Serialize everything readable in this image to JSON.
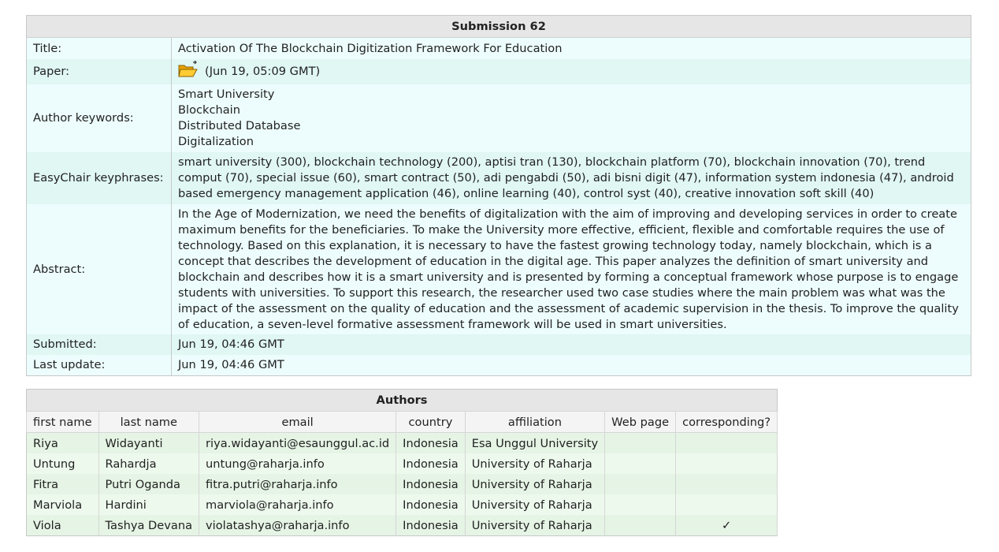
{
  "submission": {
    "caption": "Submission 62",
    "rows": {
      "title": {
        "label": "Title:",
        "value": "Activation Of The Blockchain Digitization Framework For Education"
      },
      "paper": {
        "label": "Paper:",
        "icon": "folder-icon",
        "value": "(Jun 19, 05:09 GMT)"
      },
      "keywords": {
        "label": "Author keywords:",
        "values": [
          "Smart University",
          "Blockchain",
          "Distributed Database",
          "Digitalization"
        ]
      },
      "keyphrases": {
        "label": "EasyChair keyphrases:",
        "value": "smart university (300), blockchain technology (200), aptisi tran (130), blockchain platform (70), blockchain innovation (70), trend comput (70), special issue (60), smart contract (50), adi pengabdi (50), adi bisni digit (47), information system indonesia (47), android based emergency management application (46), online learning (40), control syst (40), creative innovation soft skill (40)"
      },
      "abstract": {
        "label": "Abstract:",
        "value": "In the Age of Modernization, we need the benefits of digitalization with the aim of improving and developing services in order to create maximum benefits for the beneficiaries. To make the University more effective, efficient, flexible and comfortable requires the use of technology. Based on this explanation, it is necessary to have the fastest growing technology today, namely blockchain, which is a concept that describes the development of education in the digital age. This paper analyzes the definition of smart university and blockchain and describes how it is a smart university and is presented by forming a conceptual framework whose purpose is to engage students with universities. To support this research, the researcher used two case studies where the main problem was what was the impact of the assessment on the quality of education and the assessment of academic supervision in the thesis. To improve the quality of education, a seven-level formative assessment framework will be used in smart universities."
      },
      "submitted": {
        "label": "Submitted:",
        "value": "Jun 19, 04:46 GMT"
      },
      "last_update": {
        "label": "Last update:",
        "value": "Jun 19, 04:46 GMT"
      }
    }
  },
  "authors": {
    "caption": "Authors",
    "columns": [
      "first name",
      "last name",
      "email",
      "country",
      "affiliation",
      "Web page",
      "corresponding?"
    ],
    "rows": [
      {
        "first": "Riya",
        "last": "Widayanti",
        "email": "riya.widayanti@esaunggul.ac.id",
        "country": "Indonesia",
        "affiliation": "Esa Unggul University",
        "web": "",
        "corresponding": ""
      },
      {
        "first": "Untung",
        "last": "Rahardja",
        "email": "untung@raharja.info",
        "country": "Indonesia",
        "affiliation": "University of Raharja",
        "web": "",
        "corresponding": ""
      },
      {
        "first": "Fitra",
        "last": "Putri Oganda",
        "email": "fitra.putri@raharja.info",
        "country": "Indonesia",
        "affiliation": "University of Raharja",
        "web": "",
        "corresponding": ""
      },
      {
        "first": "Marviola",
        "last": "Hardini",
        "email": "marviola@raharja.info",
        "country": "Indonesia",
        "affiliation": "University of Raharja",
        "web": "",
        "corresponding": ""
      },
      {
        "first": "Viola",
        "last": "Tashya Devana",
        "email": "violatashya@raharja.info",
        "country": "Indonesia",
        "affiliation": "University of Raharja",
        "web": "",
        "corresponding": "✓"
      }
    ]
  },
  "colors": {
    "header_bg": "#e6e6e6",
    "submission_row_a": "#e0f7f4",
    "submission_row_b": "#edfdfd",
    "author_row_a": "#e5f4e5",
    "author_row_b": "#eef9ee",
    "folder_icon": "#f5b400"
  }
}
